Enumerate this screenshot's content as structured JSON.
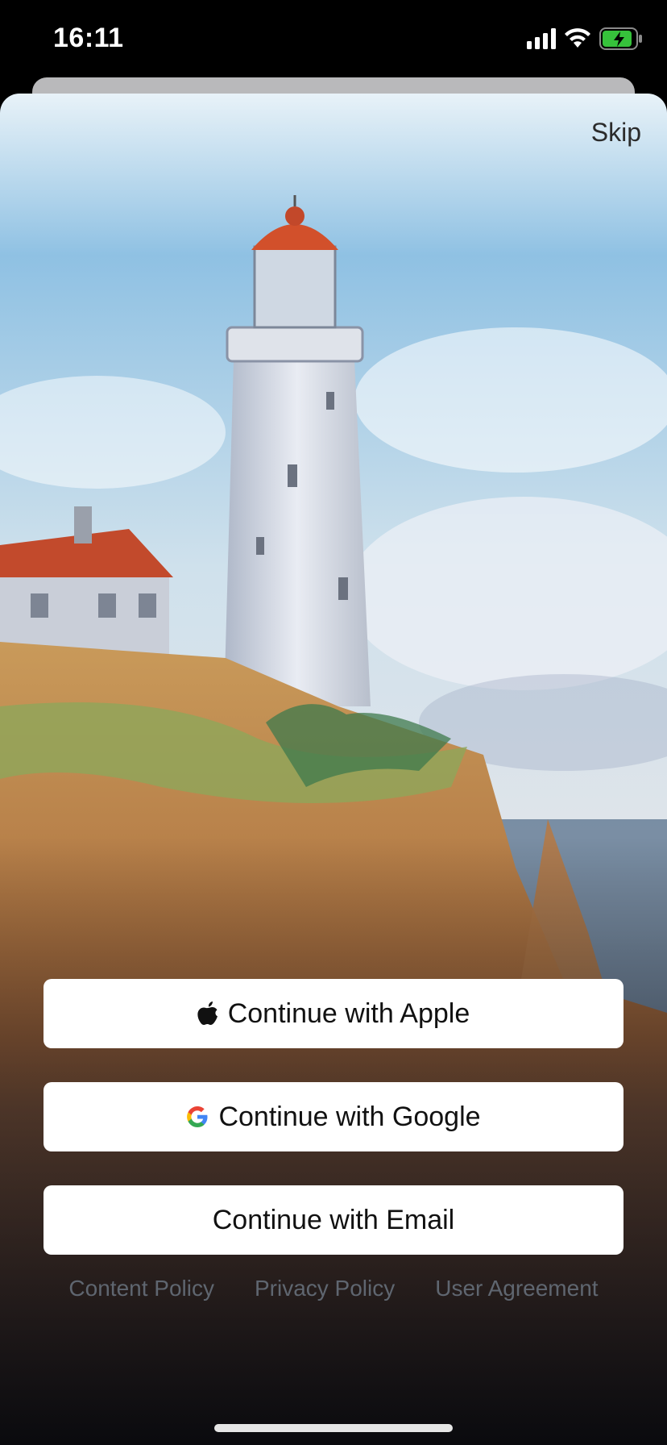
{
  "status_bar": {
    "time": "16:11",
    "icons": [
      "cellular-signal-icon",
      "wifi-icon",
      "battery-charging-icon"
    ],
    "battery_color": "#36c23b"
  },
  "onboarding": {
    "skip_label": "Skip",
    "background_image": "watercolor-lighthouse-illustration",
    "auth_buttons": [
      {
        "label": "Continue with Apple",
        "icon": "apple-icon"
      },
      {
        "label": "Continue with Google",
        "icon": "google-icon"
      },
      {
        "label": "Continue with Email",
        "icon": null
      }
    ],
    "footer_links": [
      "Content Policy",
      "Privacy Policy",
      "User Agreement"
    ]
  },
  "colors": {
    "button_bg": "#ffffff",
    "button_text": "#111111",
    "link_text": "#5f6670"
  }
}
